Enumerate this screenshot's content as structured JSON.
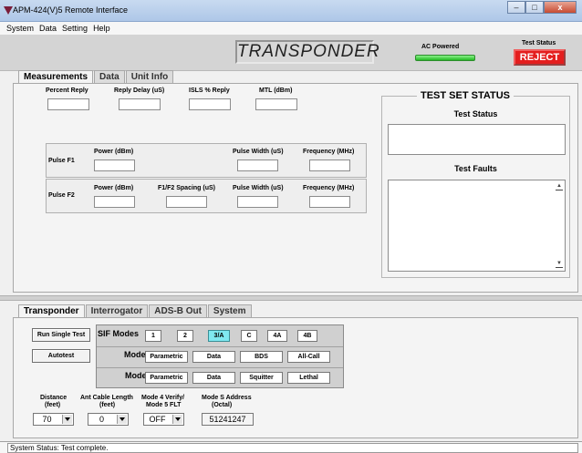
{
  "window": {
    "title": "APM-424(V)5 Remote Interface"
  },
  "menu": [
    "System",
    "Data",
    "Setting",
    "Help"
  ],
  "header": {
    "mode_title": "TRANSPONDER",
    "ac_label": "AC Powered",
    "test_status_label": "Test Status",
    "test_status_value": "REJECT",
    "reject_color": "#e41e1e"
  },
  "upper_tabs": [
    "Measurements",
    "Data",
    "Unit Info"
  ],
  "measurements": {
    "percent_reply": "Percent Reply",
    "reply_delay": "Reply Delay (uS)",
    "isls_reply": "ISLS % Reply",
    "mtl": "MTL (dBm)",
    "pulse_f1": {
      "label": "Pulse F1",
      "power": "Power (dBm)",
      "pulse_width": "Pulse Width (uS)",
      "frequency": "Frequency (MHz)"
    },
    "pulse_f2": {
      "label": "Pulse F2",
      "power": "Power (dBm)",
      "spacing": "F1/F2 Spacing (uS)",
      "pulse_width": "Pulse Width (uS)",
      "frequency": "Frequency (MHz)"
    }
  },
  "test_set_status": {
    "title": "TEST SET STATUS",
    "test_status": "Test Status",
    "test_faults": "Test Faults"
  },
  "lower_tabs": [
    "Transponder",
    "Interrogator",
    "ADS-B Out",
    "System"
  ],
  "buttons": {
    "run_single": "Run Single Test",
    "autotest": "Autotest"
  },
  "sif": {
    "label": "SIF Modes",
    "modes": [
      "1",
      "2",
      "3/A",
      "C",
      "4A",
      "4B"
    ],
    "active": "3/A"
  },
  "mode_s": {
    "label": "Mode S",
    "options": [
      "Parametric",
      "Data",
      "BDS",
      "All-Call"
    ]
  },
  "mode_5": {
    "label": "Mode 5",
    "options": [
      "Parametric",
      "Data",
      "Squitter",
      "Lethal"
    ]
  },
  "settings": {
    "distance": {
      "label1": "Distance",
      "label2": "(feet)",
      "value": "70"
    },
    "cable": {
      "label1": "Ant Cable Length",
      "label2": "(feet)",
      "value": "0"
    },
    "mode4": {
      "label1": "Mode 4 Verify/",
      "label2": "Mode 5 FLT",
      "value": "OFF"
    },
    "address": {
      "label1": "Mode S Address",
      "label2": "(Octal)",
      "value": "51241247"
    }
  },
  "status_bar": "System Status: Test complete."
}
